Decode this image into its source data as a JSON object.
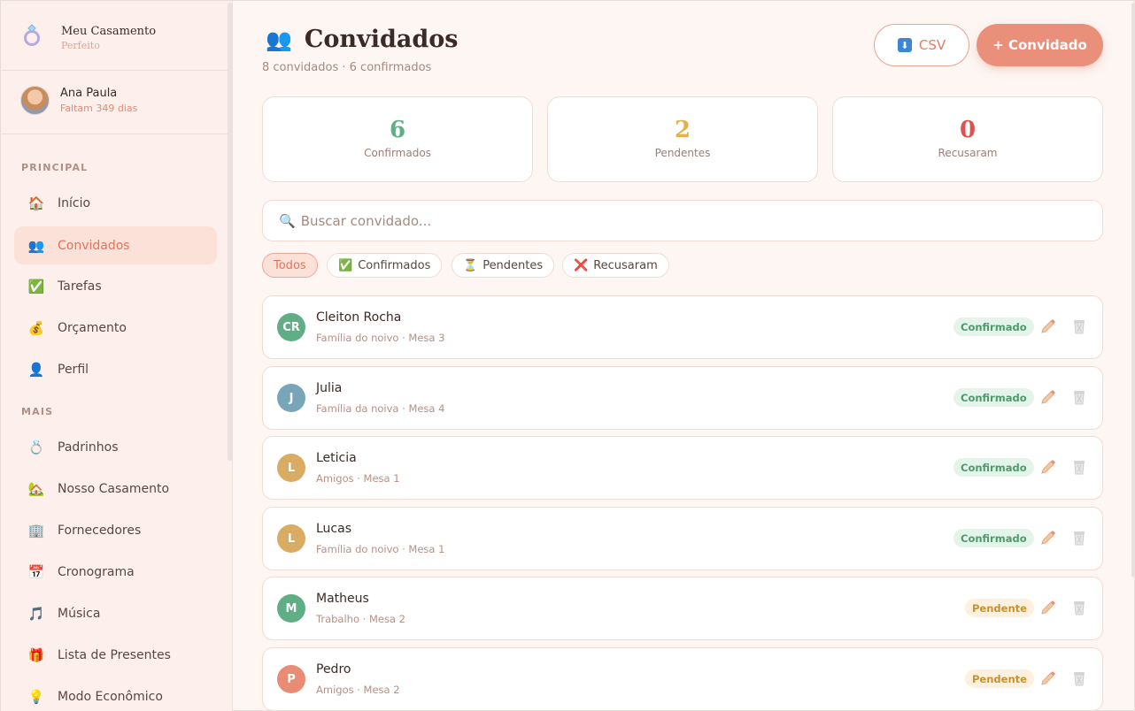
{
  "app": {
    "brand_icon": "ring-icon",
    "brand_title": "Meu Casamento",
    "brand_subtitle": "Perfeito"
  },
  "user": {
    "name": "Ana Paula",
    "countdown": "Faltam 349 dias"
  },
  "sidebar": {
    "section_principal": "PRINCIPAL",
    "section_mais": "MAIS",
    "principal": [
      {
        "label": "Início",
        "icon": "🏠"
      },
      {
        "label": "Convidados",
        "icon": "👥",
        "active": true
      },
      {
        "label": "Tarefas",
        "icon": "✅"
      },
      {
        "label": "Orçamento",
        "icon": "💰"
      },
      {
        "label": "Perfil",
        "icon": "👤"
      }
    ],
    "mais": [
      {
        "label": "Padrinhos",
        "icon": "💍"
      },
      {
        "label": "Nosso Casamento",
        "icon": "🏡"
      },
      {
        "label": "Fornecedores",
        "icon": "🏢"
      },
      {
        "label": "Cronograma",
        "icon": "📅"
      },
      {
        "label": "Música",
        "icon": "🎵"
      },
      {
        "label": "Lista de Presentes",
        "icon": "🎁"
      },
      {
        "label": "Modo Econômico",
        "icon": "💡"
      }
    ]
  },
  "header": {
    "title": "Convidados",
    "title_icon": "👥",
    "subtitle": "8 convidados · 6 confirmados",
    "csv_label": "CSV",
    "add_label": "+ Convidado"
  },
  "stats": [
    {
      "value": "6",
      "label": "Confirmados",
      "color": "#5fae86"
    },
    {
      "value": "2",
      "label": "Pendentes",
      "color": "#e0b24e"
    },
    {
      "value": "0",
      "label": "Recusaram",
      "color": "#d9534f"
    }
  ],
  "search": {
    "placeholder": "Buscar convidado..."
  },
  "filters": [
    {
      "label": "Todos",
      "icon": ""
    },
    {
      "label": "Confirmados",
      "icon": "✅"
    },
    {
      "label": "Pendentes",
      "icon": "⏳"
    },
    {
      "label": "Recusaram",
      "icon": "❌"
    }
  ],
  "guests": [
    {
      "initials": "CR",
      "name": "Cleiton Rocha",
      "meta": "Família do noivo · Mesa 3",
      "status": "Confirmado",
      "status_type": "conf",
      "color": "#5fae86"
    },
    {
      "initials": "J",
      "name": "Julia",
      "meta": "Família da noiva · Mesa 4",
      "status": "Confirmado",
      "status_type": "conf",
      "color": "#78a6b8"
    },
    {
      "initials": "L",
      "name": "Leticia",
      "meta": "Amigos · Mesa 1",
      "status": "Confirmado",
      "status_type": "conf",
      "color": "#d9ab63"
    },
    {
      "initials": "L",
      "name": "Lucas",
      "meta": "Família do noivo · Mesa 1",
      "status": "Confirmado",
      "status_type": "conf",
      "color": "#d9ab63"
    },
    {
      "initials": "M",
      "name": "Matheus",
      "meta": "Trabalho · Mesa 2",
      "status": "Pendente",
      "status_type": "pend",
      "color": "#5fae86"
    },
    {
      "initials": "P",
      "name": "Pedro",
      "meta": "Amigos · Mesa 2",
      "status": "Pendente",
      "status_type": "pend",
      "color": "#e88c74"
    }
  ]
}
